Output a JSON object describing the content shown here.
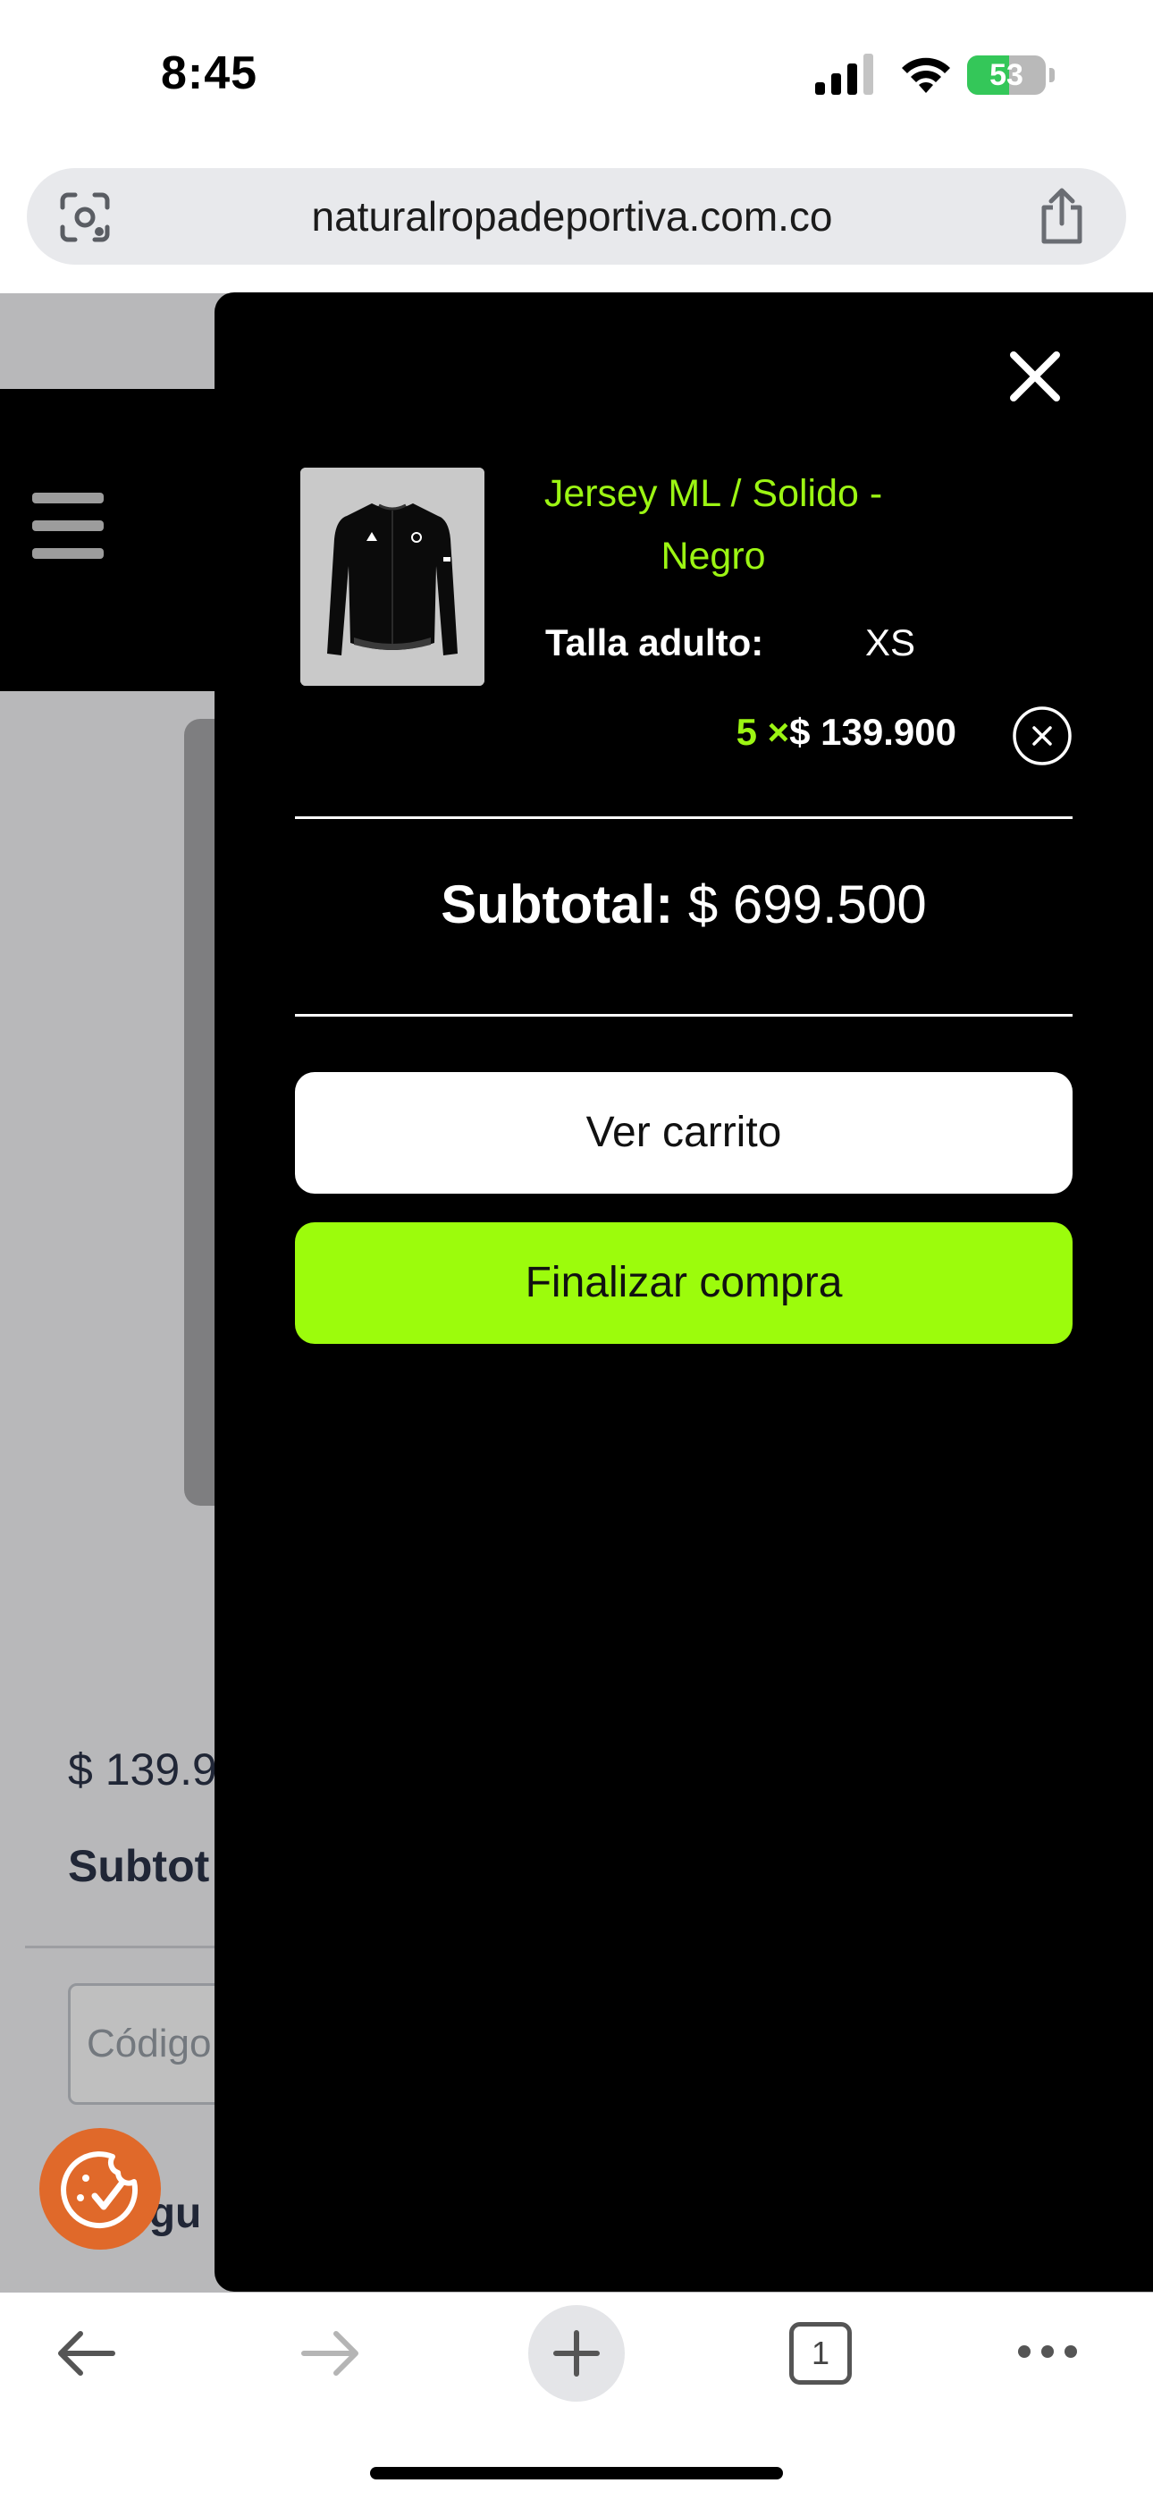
{
  "status_bar": {
    "time": "8:45",
    "battery": "53",
    "battery_level": 0.53,
    "battery_color": "#34c759"
  },
  "browser": {
    "url": "naturalropadeportiva.com.co",
    "icons": [
      "lens-icon",
      "share-icon"
    ]
  },
  "background_page": {
    "price": "$ 139.9",
    "subtotal_label": "Subtot",
    "coupon_placeholder": "Código",
    "continue_label": "egu"
  },
  "cart": {
    "item": {
      "name": "Jersey ML / Solido - Negro",
      "attribute_label": "Talla adulto:",
      "attribute_value": "XS",
      "quantity": "5",
      "times": "×",
      "unit_price": "$ 139.900"
    },
    "subtotal_label": "Subtotal:",
    "subtotal_value": "$ 699.500",
    "view_cart_label": "Ver carrito",
    "checkout_label": "Finalizar compra",
    "accent_color": "#9cf513",
    "checkout_color": "#9cfc0c"
  },
  "toolbar": {
    "tab_count": "1",
    "icons": [
      "back-arrow-icon",
      "forward-arrow-icon",
      "new-tab-icon",
      "tabs-icon",
      "more-icon"
    ]
  },
  "cookie": {
    "color": "#e0692a",
    "icon": "cookie-check-icon"
  }
}
